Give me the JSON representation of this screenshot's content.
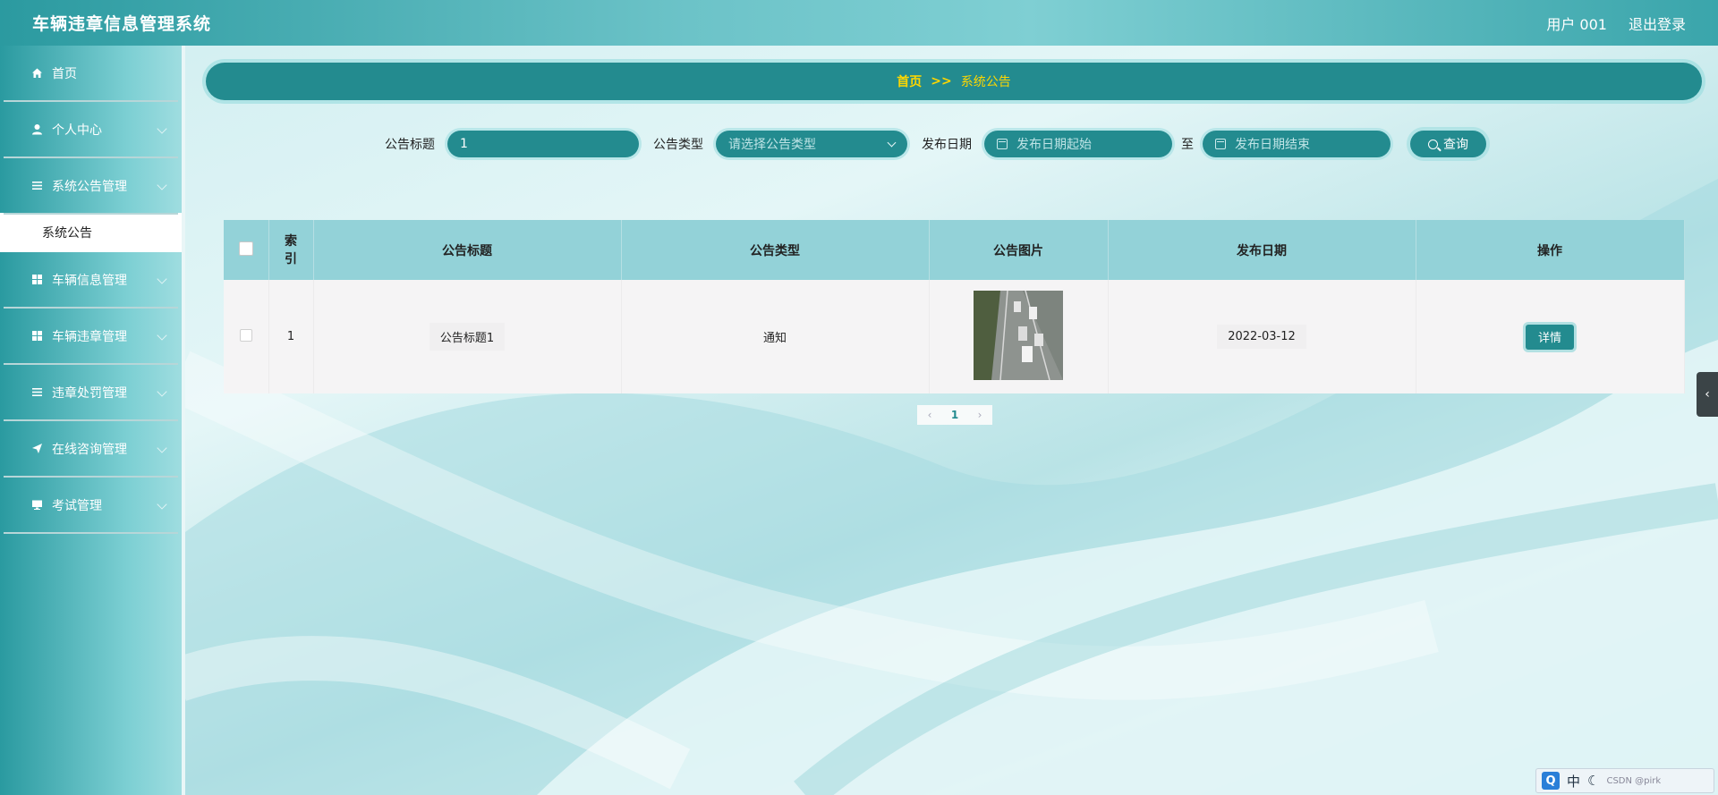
{
  "app": {
    "title": "车辆违章信息管理系统"
  },
  "header": {
    "user_label": "用户 001",
    "logout_label": "退出登录"
  },
  "sidebar": {
    "items": [
      {
        "label": "首页",
        "icon": "home-icon"
      },
      {
        "label": "个人中心",
        "icon": "user-icon"
      },
      {
        "label": "系统公告管理",
        "icon": "list-icon"
      },
      {
        "label": "车辆信息管理",
        "icon": "grid-icon"
      },
      {
        "label": "车辆违章管理",
        "icon": "grid-icon"
      },
      {
        "label": "违章处罚管理",
        "icon": "list-icon"
      },
      {
        "label": "在线咨询管理",
        "icon": "send-icon"
      },
      {
        "label": "考试管理",
        "icon": "monitor-icon"
      }
    ],
    "submenu": {
      "label": "系统公告"
    }
  },
  "breadcrumb": {
    "home": "首页",
    "separator": ">>",
    "current": "系统公告"
  },
  "search": {
    "title_label": "公告标题",
    "title_value": "1",
    "type_label": "公告类型",
    "type_placeholder": "请选择公告类型",
    "date_label": "发布日期",
    "date_start_placeholder": "发布日期起始",
    "date_to": "至",
    "date_end_placeholder": "发布日期结束",
    "query_button": "查询"
  },
  "table": {
    "headers": [
      "索引",
      "公告标题",
      "公告类型",
      "公告图片",
      "发布日期",
      "操作"
    ],
    "rows": [
      {
        "index": "1",
        "title": "公告标题1",
        "type": "通知",
        "date": "2022-03-12",
        "action": "详情"
      }
    ]
  },
  "pagination": {
    "current": "1",
    "prev": "‹",
    "next": "›"
  },
  "ime": {
    "q": "Q",
    "lang": "中",
    "watermark": "CSDN @pirk"
  },
  "colors": {
    "accent": "#238b8f",
    "header_th": "#93d2d8",
    "breadcrumb_text": "#ffd700"
  }
}
